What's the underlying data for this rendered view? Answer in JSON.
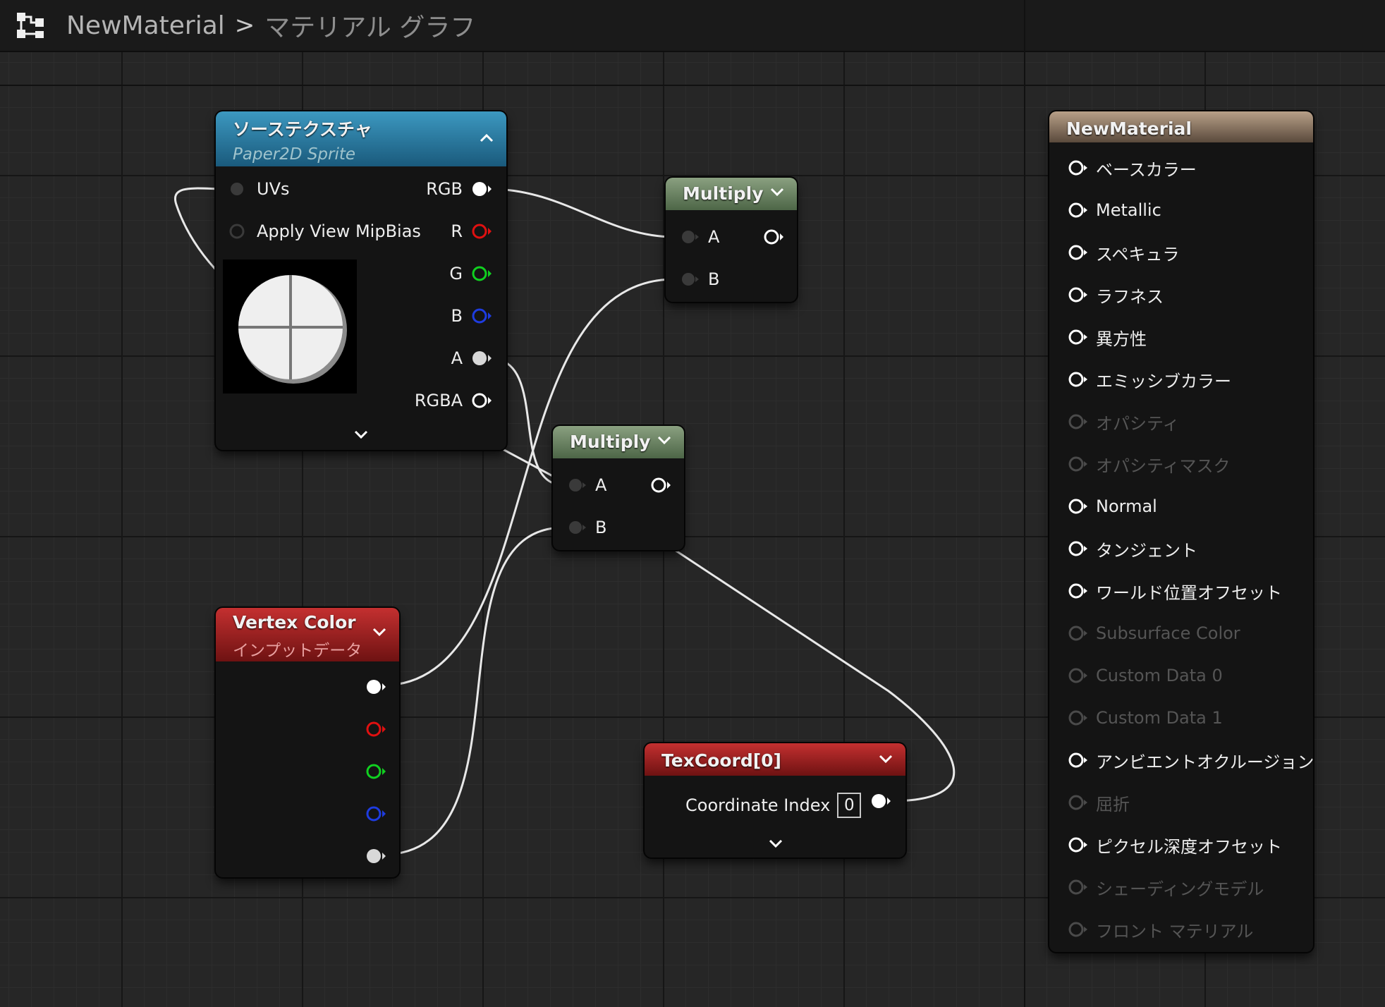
{
  "breadcrumb": {
    "root": "NewMaterial",
    "separator": ">",
    "current": "マテリアル グラフ",
    "icon": "graph-nodes-icon"
  },
  "nodes": {
    "texture_sample": {
      "title": "ソーステクスチャ",
      "subtitle": "Paper2D Sprite",
      "inputs": [
        "UVs",
        "Apply View MipBias"
      ],
      "outputs": [
        "RGB",
        "R",
        "G",
        "B",
        "A",
        "RGBA"
      ],
      "output_colors": [
        "#ffffff",
        "#e01010",
        "#10d020",
        "#1e3ce0",
        "#d8d8d8",
        "#ffffff"
      ]
    },
    "multiply_top": {
      "title": "Multiply",
      "inputs": [
        "A",
        "B"
      ]
    },
    "multiply_mid": {
      "title": "Multiply",
      "inputs": [
        "A",
        "B"
      ]
    },
    "vertex_color": {
      "title": "Vertex Color",
      "subtitle": "インプットデータ",
      "output_colors": [
        "#ffffff",
        "#e01010",
        "#10d020",
        "#1e3ce0",
        "#d8d8d8"
      ]
    },
    "texcoord": {
      "title": "TexCoord[0]",
      "param_label": "Coordinate Index",
      "param_value": "0"
    },
    "material_output": {
      "title": "NewMaterial",
      "pins": [
        {
          "label": "ベースカラー",
          "enabled": true
        },
        {
          "label": "Metallic",
          "enabled": true
        },
        {
          "label": "スペキュラ",
          "enabled": true
        },
        {
          "label": "ラフネス",
          "enabled": true
        },
        {
          "label": "異方性",
          "enabled": true
        },
        {
          "label": "エミッシブカラー",
          "enabled": true
        },
        {
          "label": "オパシティ",
          "enabled": false
        },
        {
          "label": "オパシティマスク",
          "enabled": false
        },
        {
          "label": "Normal",
          "enabled": true
        },
        {
          "label": "タンジェント",
          "enabled": true
        },
        {
          "label": "ワールド位置オフセット",
          "enabled": true
        },
        {
          "label": "Subsurface Color",
          "enabled": false
        },
        {
          "label": "Custom Data 0",
          "enabled": false
        },
        {
          "label": "Custom Data 1",
          "enabled": false
        },
        {
          "label": "アンビエントオクルージョン",
          "enabled": true
        },
        {
          "label": "屈折",
          "enabled": false
        },
        {
          "label": "ピクセル深度オフセット",
          "enabled": true
        },
        {
          "label": "シェーディングモデル",
          "enabled": false
        },
        {
          "label": "フロント マテリアル",
          "enabled": false
        }
      ]
    }
  },
  "colors": {
    "texture_header": "#2a7ea6",
    "multiply_header": "#6a8462",
    "vertex_header": "#a82222",
    "texcoord_header": "#a82222",
    "output_header": "#8a7664",
    "wire": "#e8e8e8"
  }
}
